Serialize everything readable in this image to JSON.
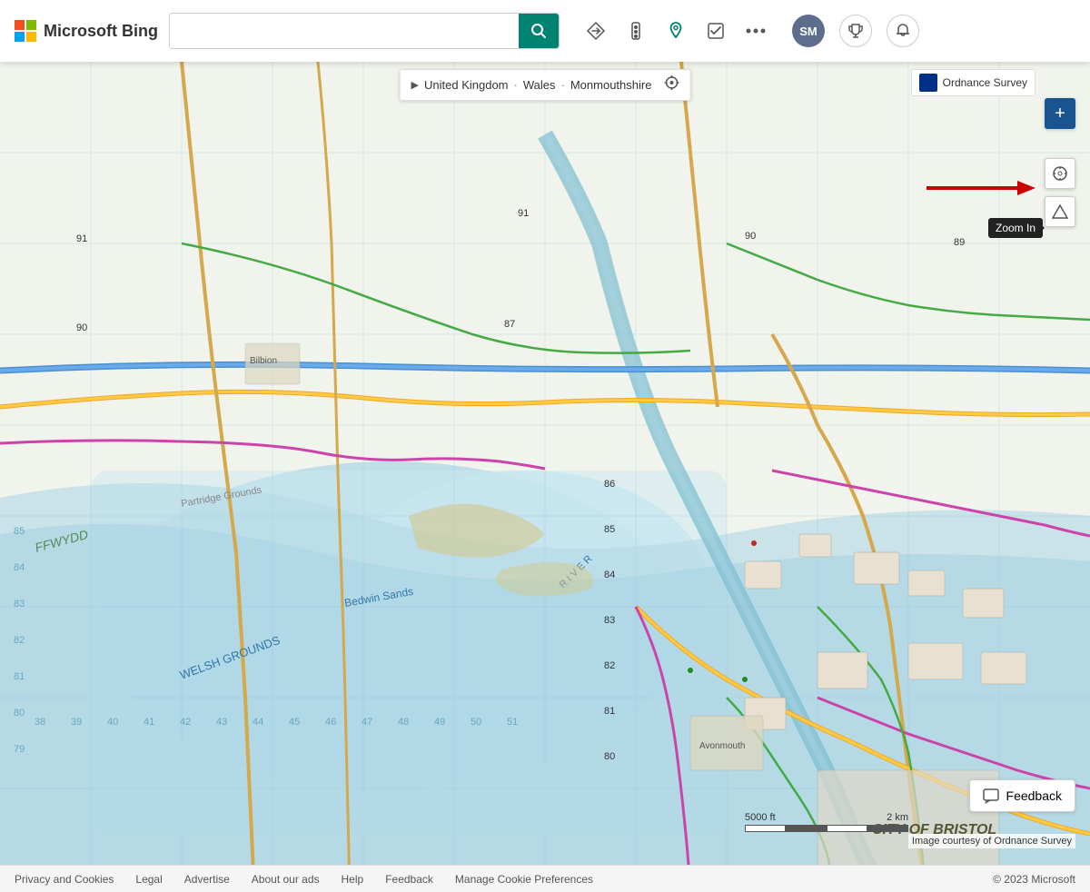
{
  "app": {
    "title": "Microsoft Bing",
    "logo_text": "Microsoft Bing"
  },
  "header": {
    "search_placeholder": "",
    "search_value": "",
    "icons": [
      {
        "name": "directions-icon",
        "symbol": "◇",
        "label": "Directions"
      },
      {
        "name": "traffic-icon",
        "symbol": "⬡",
        "label": "Traffic"
      },
      {
        "name": "pin-icon",
        "symbol": "📍",
        "label": "Pin"
      },
      {
        "name": "checklist-icon",
        "symbol": "☑",
        "label": "Checklist"
      },
      {
        "name": "more-icon",
        "symbol": "···",
        "label": "More"
      }
    ],
    "user_initials": "SM",
    "search_btn_label": "Search"
  },
  "map": {
    "source_label": "Ordnance Survey",
    "breadcrumb": {
      "arrow": "▶",
      "items": [
        "United Kingdom",
        "Wales",
        "Monmouthshire"
      ]
    },
    "zoom_in_tooltip": "Zoom In",
    "controls": [
      {
        "name": "zoom-in-button",
        "symbol": "+"
      },
      {
        "name": "compass-button",
        "symbol": "⊕"
      },
      {
        "name": "terrain-button",
        "symbol": "▲"
      }
    ]
  },
  "scale": {
    "label_left": "5000 ft",
    "label_right": "2 km"
  },
  "image_courtesy": "Image courtesy of Ordnance Survey",
  "feedback": {
    "label": "Feedback",
    "icon": "💬"
  },
  "footer": {
    "links": [
      {
        "label": "Privacy and Cookies"
      },
      {
        "label": "Legal"
      },
      {
        "label": "Advertise"
      },
      {
        "label": "About our ads"
      },
      {
        "label": "Help"
      },
      {
        "label": "Feedback"
      },
      {
        "label": "Manage Cookie Preferences"
      }
    ],
    "copyright": "© 2023 Microsoft"
  }
}
